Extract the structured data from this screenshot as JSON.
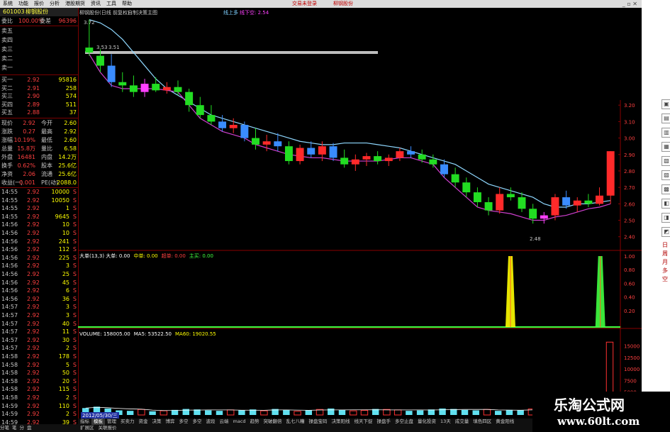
{
  "menubar": {
    "items": [
      "系统",
      "功能",
      "报价",
      "分析",
      "港股期货",
      "资讯",
      "工具",
      "帮助"
    ],
    "broker_app": "交易未登录",
    "stock_link": "柳钢股份"
  },
  "quote_panel": {
    "code": "601003",
    "name": "柳钢股份",
    "ratio_label": "委比",
    "ratio_value": "100.00%",
    "diff_label": "委差",
    "diff_value": "96396",
    "sell_levels": [
      {
        "label": "卖五",
        "price": "",
        "vol": ""
      },
      {
        "label": "卖四",
        "price": "",
        "vol": ""
      },
      {
        "label": "卖三",
        "price": "",
        "vol": ""
      },
      {
        "label": "卖二",
        "price": "",
        "vol": ""
      },
      {
        "label": "卖一",
        "price": "",
        "vol": ""
      }
    ],
    "buy_levels": [
      {
        "label": "买一",
        "price": "2.92",
        "vol": "95816"
      },
      {
        "label": "买二",
        "price": "2.91",
        "vol": "258"
      },
      {
        "label": "买三",
        "price": "2.90",
        "vol": "574"
      },
      {
        "label": "买四",
        "price": "2.89",
        "vol": "511"
      },
      {
        "label": "买五",
        "price": "2.88",
        "vol": "37"
      }
    ],
    "stats": [
      {
        "l1": "现价",
        "v1": "2.92",
        "l2": "今开",
        "v2": "2.60"
      },
      {
        "l1": "涨跌",
        "v1": "0.27",
        "l2": "最高",
        "v2": "2.92"
      },
      {
        "l1": "涨幅",
        "v1": "10.19%",
        "l2": "最低",
        "v2": "2.60"
      },
      {
        "l1": "总量",
        "v1": "15.8万",
        "l2": "量比",
        "v2": "6.58"
      },
      {
        "l1": "外盘",
        "v1": "16481",
        "l2": "内盘",
        "v2": "14.2万"
      },
      {
        "l1": "换手",
        "v1": "0.62%",
        "l2": "股本",
        "v2": "25.6亿"
      },
      {
        "l1": "净资",
        "v1": "2.06",
        "l2": "流通",
        "v2": "25.6亿"
      },
      {
        "l1": "收益(一)",
        "v1": "0.001",
        "l2": "PE(动)",
        "v2": "2088.0"
      }
    ],
    "ticks": [
      {
        "t": "14:55",
        "p": "2.92",
        "v": "10000",
        "f": "S"
      },
      {
        "t": "14:55",
        "p": "2.92",
        "v": "10050",
        "f": "S"
      },
      {
        "t": "14:55",
        "p": "2.92",
        "v": "1",
        "f": "S"
      },
      {
        "t": "14:55",
        "p": "2.92",
        "v": "9645",
        "f": "S"
      },
      {
        "t": "14:56",
        "p": "2.92",
        "v": "10",
        "f": "S"
      },
      {
        "t": "14:56",
        "p": "2.92",
        "v": "10",
        "f": "S"
      },
      {
        "t": "14:56",
        "p": "2.92",
        "v": "241",
        "f": "S"
      },
      {
        "t": "14:56",
        "p": "2.92",
        "v": "112",
        "f": "S"
      },
      {
        "t": "14:56",
        "p": "2.92",
        "v": "225",
        "f": "S"
      },
      {
        "t": "14:56",
        "p": "2.92",
        "v": "3",
        "f": "S"
      },
      {
        "t": "14:56",
        "p": "2.92",
        "v": "25",
        "f": "S"
      },
      {
        "t": "14:56",
        "p": "2.92",
        "v": "45",
        "f": "S"
      },
      {
        "t": "14:56",
        "p": "2.92",
        "v": "6",
        "f": "S"
      },
      {
        "t": "14:56",
        "p": "2.92",
        "v": "36",
        "f": "S"
      },
      {
        "t": "14:57",
        "p": "2.92",
        "v": "3",
        "f": "S"
      },
      {
        "t": "14:57",
        "p": "2.92",
        "v": "3",
        "f": "S"
      },
      {
        "t": "14:57",
        "p": "2.92",
        "v": "40",
        "f": "S"
      },
      {
        "t": "14:57",
        "p": "2.92",
        "v": "11",
        "f": "S"
      },
      {
        "t": "14:57",
        "p": "2.92",
        "v": "30",
        "f": "S"
      },
      {
        "t": "14:57",
        "p": "2.92",
        "v": "2",
        "f": "S"
      },
      {
        "t": "14:58",
        "p": "2.92",
        "v": "178",
        "f": "S"
      },
      {
        "t": "14:58",
        "p": "2.92",
        "v": "5",
        "f": "S"
      },
      {
        "t": "14:58",
        "p": "2.92",
        "v": "50",
        "f": "S"
      },
      {
        "t": "14:58",
        "p": "2.92",
        "v": "20",
        "f": "S"
      },
      {
        "t": "14:58",
        "p": "2.92",
        "v": "115",
        "f": "S"
      },
      {
        "t": "14:58",
        "p": "2.92",
        "v": "2",
        "f": "S"
      },
      {
        "t": "14:59",
        "p": "2.92",
        "v": "110",
        "f": "S"
      },
      {
        "t": "14:59",
        "p": "2.92",
        "v": "2",
        "f": "S"
      },
      {
        "t": "14:59",
        "p": "2.92",
        "v": "39",
        "f": "S"
      }
    ],
    "status_tabs": [
      "分笔",
      "笔",
      "分",
      "盘"
    ]
  },
  "chart_header": {
    "stock": "柳钢股份(日线 前复权)",
    "indicator": "自制决策主图",
    "line_up": "线上多",
    "line_down": "线下空: 2.54",
    "high_mark": "3.72",
    "mark1": "3.53",
    "mark2": "3.51",
    "low_mark": "2.48"
  },
  "price_axis": [
    "3.20",
    "3.10",
    "3.00",
    "2.90",
    "2.80",
    "2.70",
    "2.60",
    "2.50",
    "2.40"
  ],
  "sub1": {
    "labels": [
      {
        "text": "大单(13,3) 大单: 0.00",
        "color": "#ffffff"
      },
      {
        "text": "中单: 0.00",
        "color": "#ffff00"
      },
      {
        "text": "超单: 0.00",
        "color": "#ff4040"
      },
      {
        "text": "主买: 0.00",
        "color": "#40ff40"
      }
    ],
    "axis": [
      "1.00",
      "0.80",
      "0.60",
      "0.40",
      "0.20"
    ]
  },
  "sub2": {
    "labels": [
      {
        "text": "VOLUME: 158005.00",
        "color": "#ffffff"
      },
      {
        "text": "MA5: 53522.50",
        "color": "#ffffff"
      },
      {
        "text": "MA60: 19020.55",
        "color": "#ffff00"
      }
    ],
    "axis": [
      "15000",
      "12500",
      "10000",
      "7500",
      "5000",
      "2500"
    ]
  },
  "date_label": "2012/05/30/三",
  "bottom_tabs": [
    "指标",
    "模板",
    "管理",
    "买卖力",
    "资金",
    "决策",
    "博弈",
    "多空",
    "多空",
    "波段",
    "云端",
    "macd",
    "趋势",
    "突破翻倍",
    "乱七八糟",
    "操盘宝码",
    "决策阳线",
    "线天下捉",
    "操盘手",
    "多空止盘",
    "量化投资",
    "13天",
    "成交量",
    "填色四区",
    "黄金阳线"
  ],
  "bottom_tabs_row2": [
    "扩展区",
    "关联报价"
  ],
  "right_strip_text": [
    "日",
    "周",
    "月",
    "多",
    "空"
  ],
  "watermark": {
    "cn": "乐淘公式网",
    "url": "www.60lt.com"
  },
  "chart_data": {
    "type": "candlestick",
    "price_candles": [
      {
        "o": 3.55,
        "h": 3.72,
        "l": 3.5,
        "c": 3.52
      },
      {
        "o": 3.5,
        "h": 3.54,
        "l": 3.4,
        "c": 3.44
      },
      {
        "o": 3.44,
        "h": 3.51,
        "l": 3.31,
        "c": 3.34
      },
      {
        "o": 3.34,
        "h": 3.4,
        "l": 3.28,
        "c": 3.32
      },
      {
        "o": 3.32,
        "h": 3.38,
        "l": 3.25,
        "c": 3.28
      },
      {
        "o": 3.28,
        "h": 3.36,
        "l": 3.25,
        "c": 3.33
      },
      {
        "o": 3.33,
        "h": 3.37,
        "l": 3.28,
        "c": 3.29
      },
      {
        "o": 3.29,
        "h": 3.34,
        "l": 3.27,
        "c": 3.31
      },
      {
        "o": 3.31,
        "h": 3.35,
        "l": 3.26,
        "c": 3.28
      },
      {
        "o": 3.28,
        "h": 3.3,
        "l": 3.16,
        "c": 3.2
      },
      {
        "o": 3.2,
        "h": 3.25,
        "l": 3.12,
        "c": 3.14
      },
      {
        "o": 3.14,
        "h": 3.2,
        "l": 3.08,
        "c": 3.1
      },
      {
        "o": 3.1,
        "h": 3.14,
        "l": 3.04,
        "c": 3.06
      },
      {
        "o": 3.06,
        "h": 3.12,
        "l": 3.03,
        "c": 3.08
      },
      {
        "o": 3.08,
        "h": 3.1,
        "l": 2.98,
        "c": 3.0
      },
      {
        "o": 3.0,
        "h": 3.06,
        "l": 2.93,
        "c": 2.96
      },
      {
        "o": 2.96,
        "h": 3.02,
        "l": 2.92,
        "c": 2.98
      },
      {
        "o": 2.98,
        "h": 3.03,
        "l": 2.92,
        "c": 2.95
      },
      {
        "o": 2.95,
        "h": 2.98,
        "l": 2.84,
        "c": 2.86
      },
      {
        "o": 2.86,
        "h": 2.96,
        "l": 2.84,
        "c": 2.94
      },
      {
        "o": 2.94,
        "h": 2.98,
        "l": 2.88,
        "c": 2.9
      },
      {
        "o": 2.9,
        "h": 2.98,
        "l": 2.86,
        "c": 2.95
      },
      {
        "o": 2.95,
        "h": 2.97,
        "l": 2.86,
        "c": 2.88
      },
      {
        "o": 2.88,
        "h": 2.93,
        "l": 2.82,
        "c": 2.84
      },
      {
        "o": 2.84,
        "h": 2.9,
        "l": 2.8,
        "c": 2.87
      },
      {
        "o": 2.87,
        "h": 2.91,
        "l": 2.83,
        "c": 2.89
      },
      {
        "o": 2.89,
        "h": 2.92,
        "l": 2.84,
        "c": 2.86
      },
      {
        "o": 2.86,
        "h": 2.9,
        "l": 2.83,
        "c": 2.88
      },
      {
        "o": 2.88,
        "h": 2.94,
        "l": 2.86,
        "c": 2.92
      },
      {
        "o": 2.92,
        "h": 2.95,
        "l": 2.88,
        "c": 2.9
      },
      {
        "o": 2.9,
        "h": 2.93,
        "l": 2.85,
        "c": 2.87
      },
      {
        "o": 2.87,
        "h": 2.9,
        "l": 2.82,
        "c": 2.84
      },
      {
        "o": 2.84,
        "h": 2.87,
        "l": 2.76,
        "c": 2.78
      },
      {
        "o": 2.78,
        "h": 2.82,
        "l": 2.7,
        "c": 2.73
      },
      {
        "o": 2.73,
        "h": 2.76,
        "l": 2.64,
        "c": 2.67
      },
      {
        "o": 2.67,
        "h": 2.7,
        "l": 2.58,
        "c": 2.61
      },
      {
        "o": 2.61,
        "h": 2.64,
        "l": 2.53,
        "c": 2.56
      },
      {
        "o": 2.56,
        "h": 2.7,
        "l": 2.54,
        "c": 2.66
      },
      {
        "o": 2.66,
        "h": 2.7,
        "l": 2.62,
        "c": 2.64
      },
      {
        "o": 2.64,
        "h": 2.67,
        "l": 2.55,
        "c": 2.57
      },
      {
        "o": 2.57,
        "h": 2.6,
        "l": 2.48,
        "c": 2.51
      },
      {
        "o": 2.51,
        "h": 2.55,
        "l": 2.48,
        "c": 2.53
      },
      {
        "o": 2.53,
        "h": 2.66,
        "l": 2.5,
        "c": 2.64
      },
      {
        "o": 2.64,
        "h": 2.68,
        "l": 2.57,
        "c": 2.59
      },
      {
        "o": 2.59,
        "h": 2.64,
        "l": 2.55,
        "c": 2.62
      },
      {
        "o": 2.62,
        "h": 2.66,
        "l": 2.58,
        "c": 2.6
      },
      {
        "o": 2.6,
        "h": 2.7,
        "l": 2.59,
        "c": 2.65
      },
      {
        "o": 2.65,
        "h": 2.92,
        "l": 2.6,
        "c": 2.92
      }
    ],
    "line_up": [
      3.72,
      3.7,
      3.66,
      3.6,
      3.52,
      3.44,
      3.36,
      3.3,
      3.26,
      3.22,
      3.18,
      3.14,
      3.12,
      3.1,
      3.08,
      3.06,
      3.04,
      3.02,
      3.0,
      2.98,
      2.97,
      2.96,
      2.96,
      2.97,
      2.97,
      2.97,
      2.96,
      2.95,
      2.94,
      2.92,
      2.9,
      2.88,
      2.86,
      2.84,
      2.8,
      2.76,
      2.72,
      2.7,
      2.68,
      2.66,
      2.64,
      2.6,
      2.58,
      2.58,
      2.6,
      2.6,
      2.61,
      2.62
    ],
    "line_down": [
      3.51,
      3.4,
      3.32,
      3.3,
      3.3,
      3.3,
      3.3,
      3.29,
      3.28,
      3.2,
      3.12,
      3.08,
      3.04,
      3.02,
      3.0,
      2.96,
      2.94,
      2.92,
      2.9,
      2.89,
      2.88,
      2.88,
      2.87,
      2.86,
      2.86,
      2.86,
      2.86,
      2.87,
      2.88,
      2.88,
      2.86,
      2.84,
      2.76,
      2.7,
      2.64,
      2.58,
      2.56,
      2.55,
      2.54,
      2.52,
      2.5,
      2.5,
      2.52,
      2.53,
      2.55,
      2.57,
      2.58,
      2.6
    ],
    "sub1_spikes": [
      {
        "x": 9.5,
        "color": "#ffff00",
        "value": 1.0
      },
      {
        "x": 11.5,
        "color": "#40ff40",
        "value": 1.0
      },
      {
        "x": 41.5,
        "color": "#c8c800",
        "value": 1.0
      }
    ],
    "volume": [
      15,
      18,
      14,
      10,
      9,
      12,
      8,
      9,
      11,
      13,
      12,
      10,
      9,
      11,
      10,
      12,
      9,
      13,
      11,
      8,
      10,
      12,
      14,
      11,
      9,
      10,
      13,
      12,
      11,
      9,
      10,
      12,
      14,
      13,
      11,
      10,
      12,
      9,
      11,
      10,
      13,
      14,
      12,
      11,
      9,
      10,
      20,
      158
    ],
    "volume_red": [
      false,
      false,
      false,
      false,
      false,
      true,
      false,
      true,
      false,
      false,
      false,
      false,
      false,
      true,
      false,
      false,
      true,
      false,
      false,
      true,
      false,
      true,
      false,
      false,
      true,
      true,
      false,
      true,
      true,
      false,
      false,
      false,
      false,
      false,
      false,
      false,
      true,
      false,
      false,
      false,
      true,
      true,
      false,
      true,
      false,
      true,
      true,
      true
    ],
    "price_ylim": [
      2.36,
      3.74
    ],
    "volume_ylim": [
      0,
      160
    ]
  }
}
